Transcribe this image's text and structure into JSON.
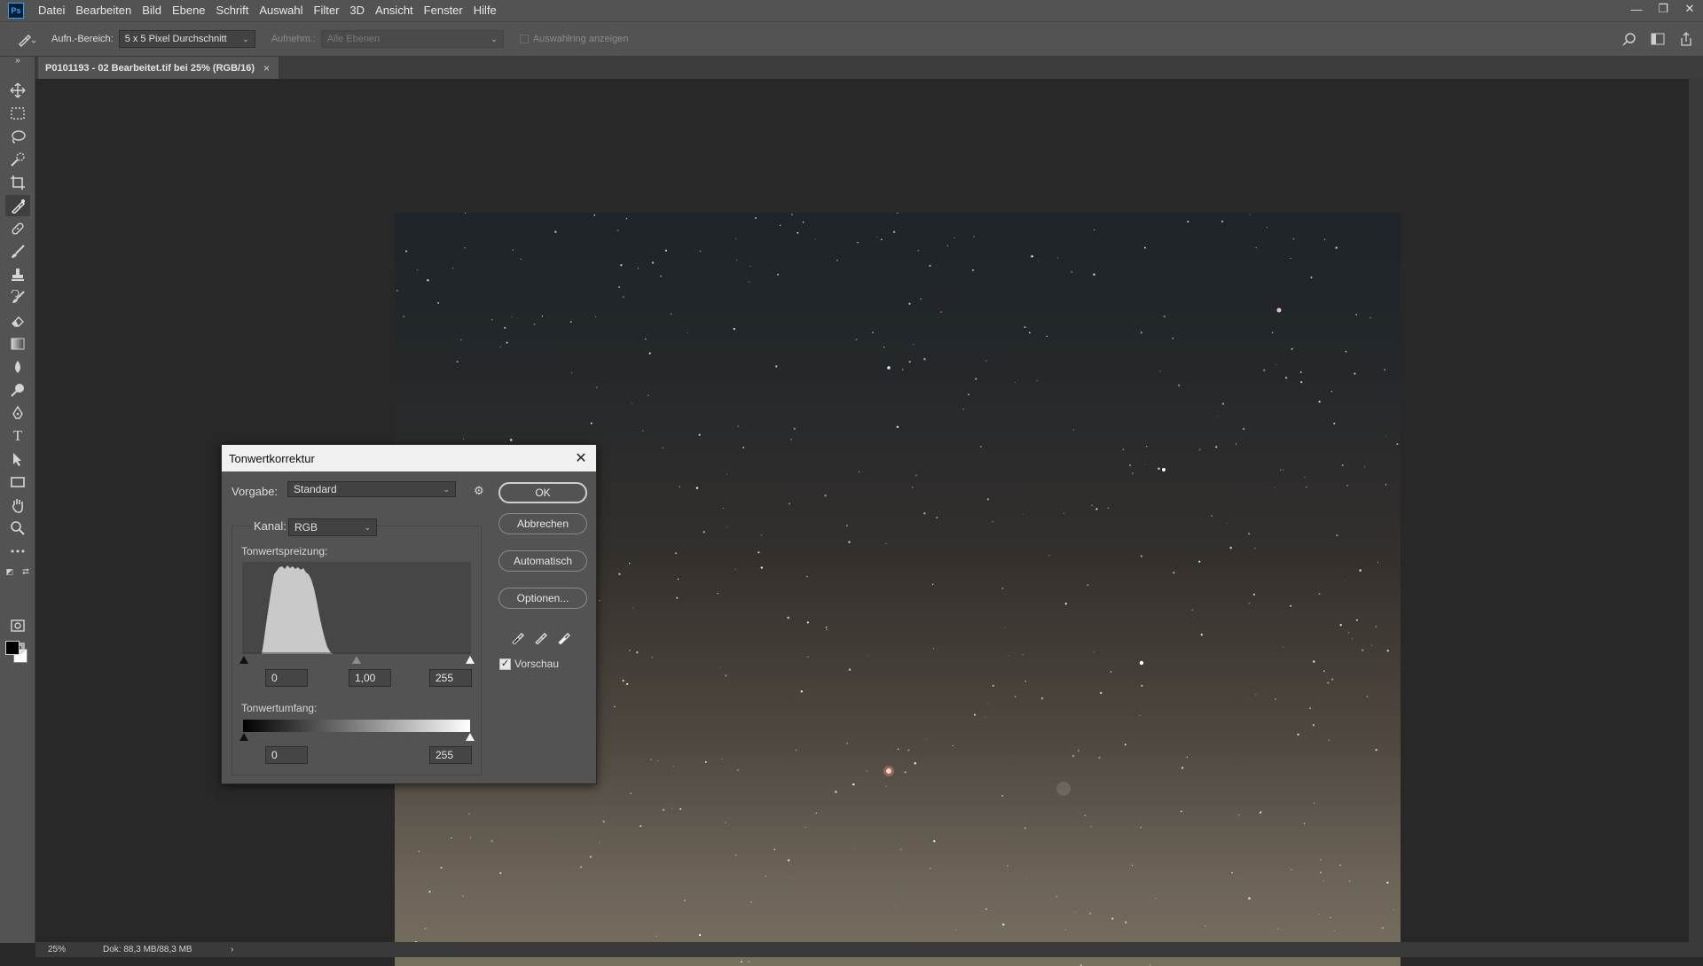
{
  "menu": {
    "logo": "Ps",
    "items": [
      "Datei",
      "Bearbeiten",
      "Bild",
      "Ebene",
      "Schrift",
      "Auswahl",
      "Filter",
      "3D",
      "Ansicht",
      "Fenster",
      "Hilfe"
    ]
  },
  "window_controls": {
    "minimize": "—",
    "restore": "❐",
    "close": "✕"
  },
  "options": {
    "sample_size_label": "Aufn.-Bereich:",
    "sample_size_value": "5 x 5 Pixel Durchschnitt",
    "sample_label": "Aufnehm.:",
    "sample_value": "Alle Ebenen",
    "show_ring_label": "Auswahlring anzeigen"
  },
  "document_tab": {
    "title": "P0101193 - 02 Bearbeitet.tif bei 25% (RGB/16)",
    "close": "×"
  },
  "status": {
    "zoom": "25%",
    "doc_size": "Dok: 88,3 MB/88,3 MB",
    "arrow": "›"
  },
  "dialog": {
    "title": "Tonwertkorrektur",
    "close": "✕",
    "preset_label": "Vorgabe:",
    "preset_value": "Standard",
    "channel_label": "Kanal:",
    "channel_value": "RGB",
    "input_levels_label": "Tonwertspreizung:",
    "input_black": "0",
    "input_gamma": "1,00",
    "input_white": "255",
    "output_levels_label": "Tonwertumfang:",
    "output_black": "0",
    "output_white": "255",
    "buttons": {
      "ok": "OK",
      "cancel": "Abbrechen",
      "auto": "Automatisch",
      "options": "Optionen..."
    },
    "preview_label": "Vorschau",
    "preview_checked": true
  },
  "tools": [
    "move-icon",
    "marquee-icon",
    "lasso-icon",
    "quick-select-icon",
    "crop-icon",
    "eyedropper-icon",
    "healing-icon",
    "brush-icon",
    "stamp-icon",
    "history-brush-icon",
    "eraser-icon",
    "gradient-icon",
    "blur-icon",
    "dodge-icon",
    "pen-icon",
    "type-icon",
    "path-select-icon",
    "rectangle-icon",
    "hand-icon",
    "zoom-icon",
    "more-icon"
  ],
  "colors": {
    "foreground": "#000000",
    "background": "#ffffff",
    "chrome": "#535353"
  }
}
